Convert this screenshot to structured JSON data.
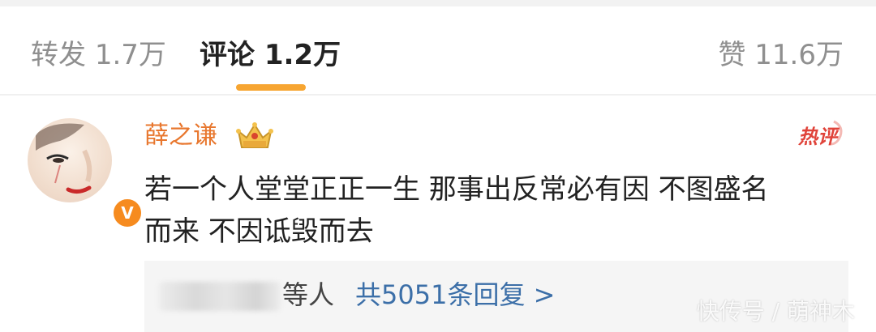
{
  "tabs": {
    "repost": {
      "label": "转发",
      "count": "1.7万"
    },
    "comment": {
      "label": "评论",
      "count": "1.2万"
    },
    "like": {
      "label": "赞",
      "count": "11.6万"
    }
  },
  "comment": {
    "username": "薛之谦",
    "hot_label": "热评",
    "verified_mark": "V",
    "text_line1": "若一个人堂堂正正一生 那事出反常必有因 不图盛名",
    "text_line2": "而来 不因诋毁而去",
    "reply_suffix": "等人",
    "reply_link": "共5051条回复 >"
  },
  "watermark": "快传号 / 萌神木",
  "colors": {
    "accent_orange": "#f7a531",
    "username": "#e8772e",
    "link_blue": "#3c6fa8",
    "hot_red": "#e0433a"
  },
  "icons": {
    "crown": "crown-icon",
    "hot": "hot-comment-icon",
    "verified": "verified-icon"
  }
}
